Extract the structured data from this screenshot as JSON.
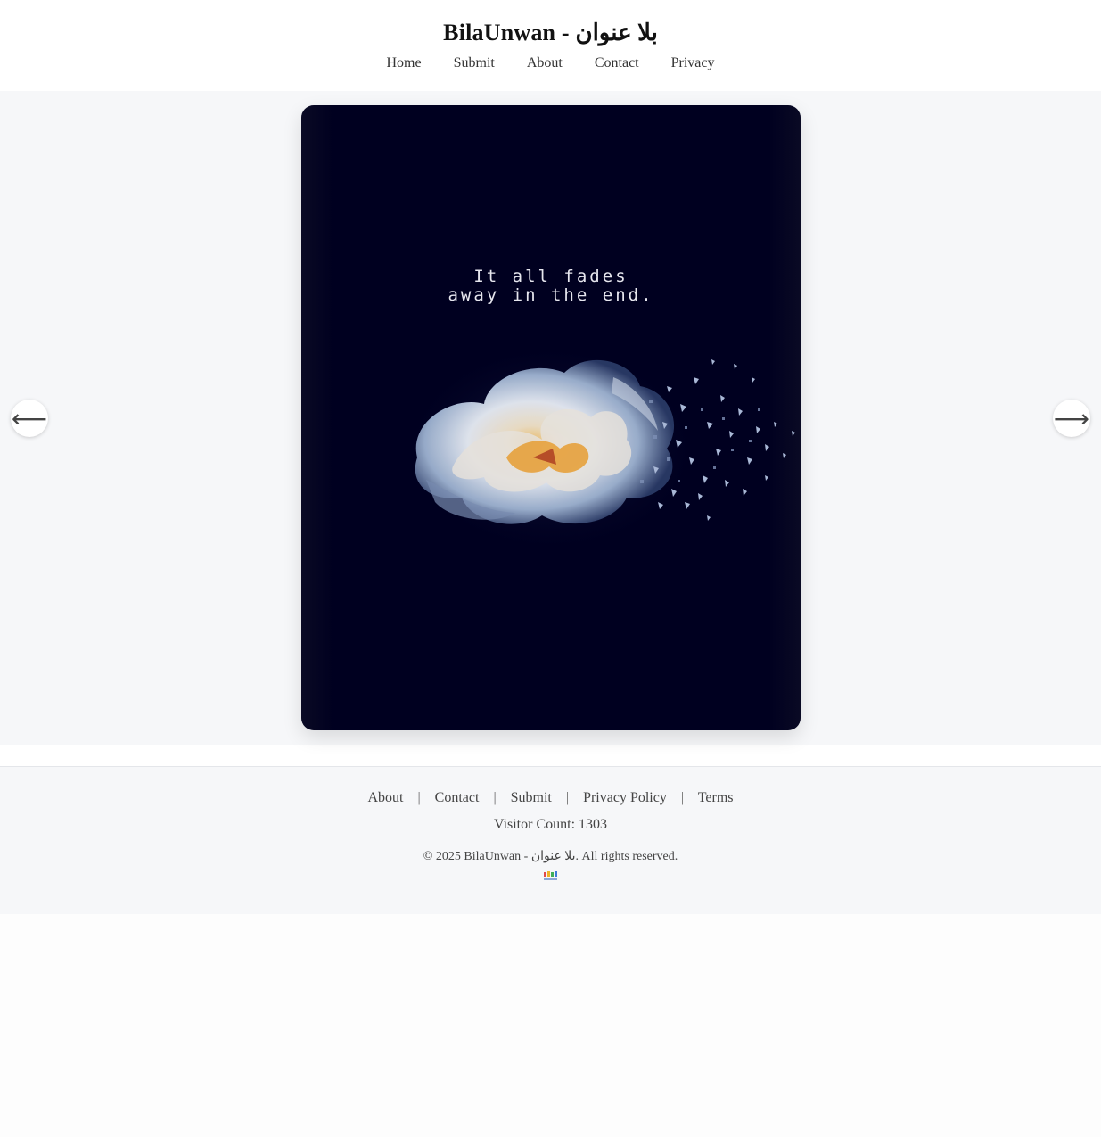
{
  "site": {
    "title": "BilaUnwan - بلا عنوان"
  },
  "nav": {
    "items": [
      {
        "label": "Home"
      },
      {
        "label": "Submit"
      },
      {
        "label": "About"
      },
      {
        "label": "Contact"
      },
      {
        "label": "Privacy"
      }
    ]
  },
  "post": {
    "quote": "It all fades\naway in the end.",
    "background_color": "#000020"
  },
  "arrows": {
    "prev": "⟵",
    "next": "⟶"
  },
  "footer": {
    "links": [
      {
        "label": "About"
      },
      {
        "label": "Contact"
      },
      {
        "label": "Submit"
      },
      {
        "label": "Privacy Policy"
      },
      {
        "label": "Terms"
      }
    ],
    "separator": "|",
    "visitor_count_label": "Visitor Count: 1303",
    "copyright": "© 2025 BilaUnwan - بلا عنوان. All rights reserved."
  }
}
